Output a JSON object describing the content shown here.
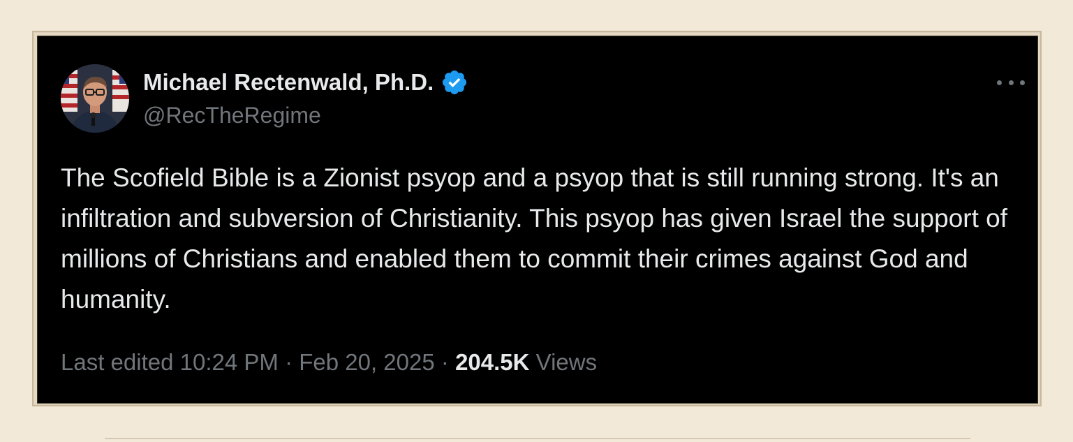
{
  "tweet": {
    "display_name": "Michael Rectenwald, Ph.D.",
    "handle": "@RecTheRegime",
    "text": "The Scofield Bible is a Zionist psyop and a psyop that is still running strong. It's an infiltration and subversion of Christianity. This psyop has given Israel the support of millions of Christians and enabled them to commit their crimes against God and humanity.",
    "edited_label": "Last edited",
    "time": "10:24 PM",
    "separator": "·",
    "date": "Feb 20, 2025",
    "views_count": "204.5K",
    "views_label": "Views",
    "verified_icon": "verified-badge-icon",
    "more_icon": "more-options-icon"
  },
  "colors": {
    "background": "#f3e9d8",
    "card": "#000000",
    "text_primary": "#e7e9ea",
    "text_secondary": "#71767b",
    "verified_blue": "#1d9bf0"
  }
}
